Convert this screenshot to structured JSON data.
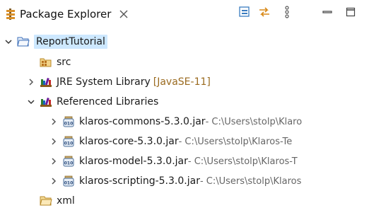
{
  "tab": {
    "title": "Package Explorer",
    "icon": "package-explorer-icon",
    "close_icon": "close-icon"
  },
  "toolbar": {
    "buttons": [
      {
        "icon": "collapse-all-icon"
      },
      {
        "icon": "link-with-editor-icon"
      },
      {
        "icon": "view-menu-icon"
      },
      {
        "icon": "minimize-icon"
      },
      {
        "icon": "maximize-icon"
      }
    ]
  },
  "tree": {
    "project": {
      "label": "ReportTutorial",
      "icon": "project-folder-icon",
      "expanded": true,
      "selected": true
    },
    "src": {
      "label": "src",
      "icon": "source-folder-icon"
    },
    "jre": {
      "label": "JRE System Library",
      "decoration": "[JavaSE-11]",
      "icon": "library-icon",
      "expanded": false
    },
    "reflibs": {
      "label": "Referenced Libraries",
      "icon": "library-icon",
      "expanded": true
    },
    "jars": [
      {
        "label": "klaros-commons-5.3.0.jar",
        "path": " - C:\\Users\\stolp\\Klaro",
        "icon": "jar-icon"
      },
      {
        "label": "klaros-core-5.3.0.jar",
        "path": " - C:\\Users\\stolp\\Klaros-Te",
        "icon": "jar-icon"
      },
      {
        "label": "klaros-model-5.3.0.jar",
        "path": " - C:\\Users\\stolp\\Klaros-T",
        "icon": "jar-icon"
      },
      {
        "label": "klaros-scripting-5.3.0.jar",
        "path": " - C:\\Users\\stolp\\Klaros",
        "icon": "jar-icon"
      }
    ],
    "xml": {
      "label": "xml",
      "icon": "folder-icon"
    }
  }
}
